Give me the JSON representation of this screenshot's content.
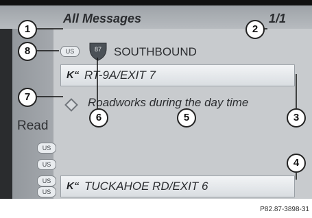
{
  "header": {
    "title": "All Messages",
    "page": "1/1"
  },
  "message": {
    "route_shield": "87",
    "direction": "SOUTHBOUND",
    "location_from": "RT-9A/EXIT 7",
    "description": "Roadworks during the day time",
    "location_to": "TUCKAHOE RD/EXIT 6"
  },
  "sidebar": {
    "read_label": "Read",
    "badges": [
      "US",
      "US",
      "US",
      "US",
      "US"
    ]
  },
  "icons": {
    "road": "road-icon",
    "event": "diamond-warning-icon",
    "shield": "route-shield-icon"
  },
  "callouts": [
    "1",
    "2",
    "3",
    "4",
    "5",
    "6",
    "7",
    "8"
  ],
  "caption": "P82.87-3898-31",
  "colors": {
    "screen_bg": "#c8cbce",
    "bar_bg": "#eef0f2",
    "text": "#2b2d30"
  }
}
